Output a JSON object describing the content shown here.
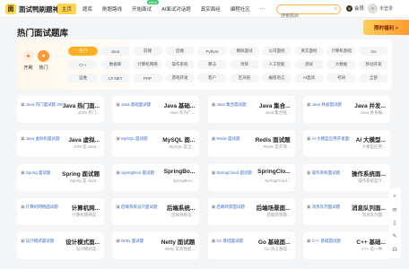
{
  "topnav": {
    "logo_mark": "面",
    "logo_text": "面试鸭刷题神器",
    "items": [
      {
        "label": "主页",
        "active": true
      },
      {
        "label": "题库"
      },
      {
        "label": "刷题路线"
      },
      {
        "label": "开始面试",
        "badge": "NEW"
      },
      {
        "label": "AI面试对话题"
      },
      {
        "label": "真实面经"
      },
      {
        "label": "编程社区"
      },
      {
        "label": "···"
      }
    ],
    "search_placeholder": "搜索题目",
    "vip_label": "会员",
    "user_label": "未登录"
  },
  "page_title": "热门面试题库",
  "banner_text": "限时福利 >",
  "hero": {
    "labels": [
      "开刷",
      "热门"
    ]
  },
  "categories": [
    "热门",
    "Java",
    "前端",
    "后端",
    "Python",
    "模拟面试",
    "公司面经",
    "真实面经",
    "计算机基础",
    "Go",
    "C++",
    "数据库",
    "计算机网络",
    "操作系统",
    "算法",
    "项目",
    "人工智能",
    "测试",
    "大数据",
    "移动开发",
    "运维",
    "C#.NET",
    "PHP",
    "游戏开发",
    "客户",
    "区块链",
    "编程语言",
    "AI面试",
    "考研",
    "全部"
  ],
  "cards": [
    {
      "thumb": "Java 热门面试题 200 道",
      "name": "Java 热门面...",
      "sub": "2025 热门..."
    },
    {
      "thumb": "Java 基础面试题",
      "name": "Java 基础...",
      "sub": "Java 作为广..."
    },
    {
      "thumb": "Java 集合面试题",
      "name": "Java 集合...",
      "sub": "Java 集合框..."
    },
    {
      "thumb": "Java 并发面试题",
      "name": "Java 并发...",
      "sub": "Java 并发编..."
    },
    {
      "thumb": "Java 虚拟机面试题",
      "name": "Java 虚拟...",
      "sub": "JVM 是 Java..."
    },
    {
      "thumb": "MySQL 面试题",
      "name": "MySQL 面...",
      "sub": "MySQL 是全..."
    },
    {
      "thumb": "Redis 面试题",
      "name": "Redis 面试题",
      "sub": "Redis 是开源..."
    },
    {
      "thumb": "AI 大模型应用开发面试题",
      "name": "AI 大模型...",
      "sub": "大模型应用..."
    },
    {
      "thumb": "Spring 面试题",
      "name": "Spring 面试题",
      "sub": "Spring 是 Java..."
    },
    {
      "thumb": "SpringBoot 面试题",
      "name": "SpringBo...",
      "sub": "SpringBoo..."
    },
    {
      "thumb": "SpringCloud 面试题",
      "name": "SpringClo...",
      "sub": "SpringCloud..."
    },
    {
      "thumb": "操作系统面试题",
      "name": "操作系统面...",
      "sub": "操作系统是计..."
    },
    {
      "thumb": "计算机网络面试题",
      "name": "计算机网...",
      "sub": "计算机网络是..."
    },
    {
      "thumb": "后端系统设计面试题",
      "name": "后端系统...",
      "sub": "后端系统设..."
    },
    {
      "thumb": "后端场景面试题",
      "name": "后端场景面...",
      "sub": "后端场景题..."
    },
    {
      "thumb": "消息队列面试题",
      "name": "消息队列面...",
      "sub": "消息队列面..."
    },
    {
      "thumb": "设计模式面试题",
      "name": "设计模式面...",
      "sub": "设计模式是..."
    },
    {
      "thumb": "Netty 面试题",
      "name": "Netty 面试题",
      "sub": "Netty 是高性能..."
    },
    {
      "thumb": "Go 基础面试题",
      "name": "Go 基础面...",
      "sub": "Go 语言基础..."
    },
    {
      "thumb": "C++ 基础面试题",
      "name": "C++ 基础...",
      "sub": "C++ 是一种..."
    }
  ],
  "sidetools": [
    "search-tool-icon",
    "wechat-icon",
    "phone-icon",
    "edit-icon",
    "headset-icon"
  ]
}
